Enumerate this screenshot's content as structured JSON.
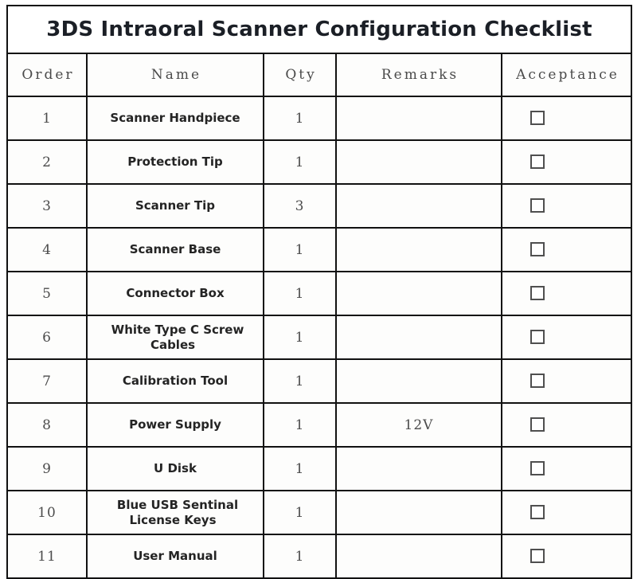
{
  "document": {
    "title": "3DS Intraoral Scanner Configuration Checklist"
  },
  "table": {
    "columns": [
      {
        "key": "order",
        "label": "Order"
      },
      {
        "key": "name",
        "label": "Name"
      },
      {
        "key": "qty",
        "label": "Qty"
      },
      {
        "key": "remarks",
        "label": "Remarks"
      },
      {
        "key": "acceptance",
        "label": "Acceptance"
      }
    ],
    "rows": [
      {
        "order": "1",
        "name": "Scanner Handpiece",
        "qty": "1",
        "remarks": "",
        "acceptance": "unchecked"
      },
      {
        "order": "2",
        "name": "Protection Tip",
        "qty": "1",
        "remarks": "",
        "acceptance": "unchecked"
      },
      {
        "order": "3",
        "name": "Scanner Tip",
        "qty": "3",
        "remarks": "",
        "acceptance": "unchecked"
      },
      {
        "order": "4",
        "name": "Scanner Base",
        "qty": "1",
        "remarks": "",
        "acceptance": "unchecked"
      },
      {
        "order": "5",
        "name": "Connector Box",
        "qty": "1",
        "remarks": "",
        "acceptance": "unchecked"
      },
      {
        "order": "6",
        "name": "White Type C Screw Cables",
        "qty": "1",
        "remarks": "",
        "acceptance": "unchecked"
      },
      {
        "order": "7",
        "name": "Calibration Tool",
        "qty": "1",
        "remarks": "",
        "acceptance": "unchecked"
      },
      {
        "order": "8",
        "name": "Power Supply",
        "qty": "1",
        "remarks": "12V",
        "acceptance": "unchecked"
      },
      {
        "order": "9",
        "name": "U Disk",
        "qty": "1",
        "remarks": "",
        "acceptance": "unchecked"
      },
      {
        "order": "10",
        "name": "Blue USB Sentinal License Keys",
        "qty": "1",
        "remarks": "",
        "acceptance": "unchecked"
      },
      {
        "order": "11",
        "name": "User Manual",
        "qty": "1",
        "remarks": "",
        "acceptance": "unchecked"
      }
    ]
  },
  "colors": {
    "border": "#111111",
    "title_text": "#1b1f26",
    "header_text": "#4a4a4a",
    "name_text": "#242424",
    "number_text": "#4c4c4c",
    "checkbox_border": "#4f4f4f",
    "page_background": "#ffffff"
  }
}
